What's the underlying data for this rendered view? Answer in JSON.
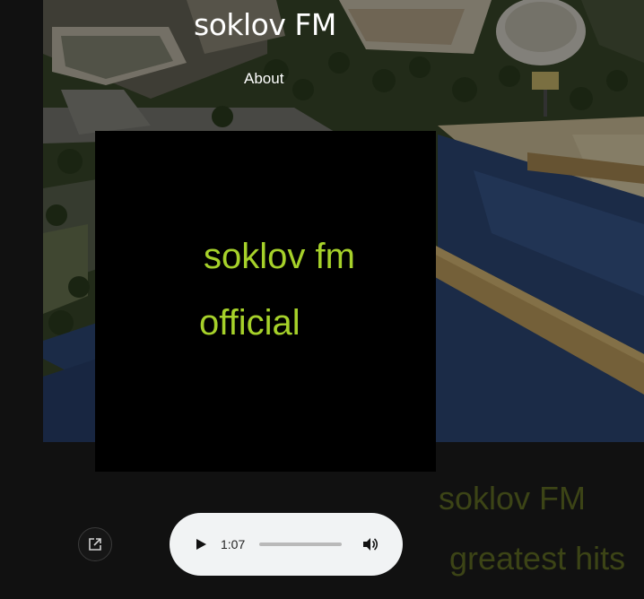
{
  "header": {
    "site_title": "soklov FM",
    "nav": [
      {
        "label": "About"
      }
    ]
  },
  "album_cover": {
    "line1": "soklov fm",
    "line2": "official",
    "text_color": "#a6d12a",
    "background": "#000000"
  },
  "side_text": {
    "title": "soklov FM",
    "subtitle": "greatest hits",
    "color": "#3c4416"
  },
  "share": {
    "icon": "external-link-icon"
  },
  "audio_player": {
    "play_icon": "play-icon",
    "current_time": "1:07",
    "progress": 0.0,
    "volume_icon": "volume-icon"
  },
  "hero_background": {
    "icon": "isometric-city-image"
  }
}
